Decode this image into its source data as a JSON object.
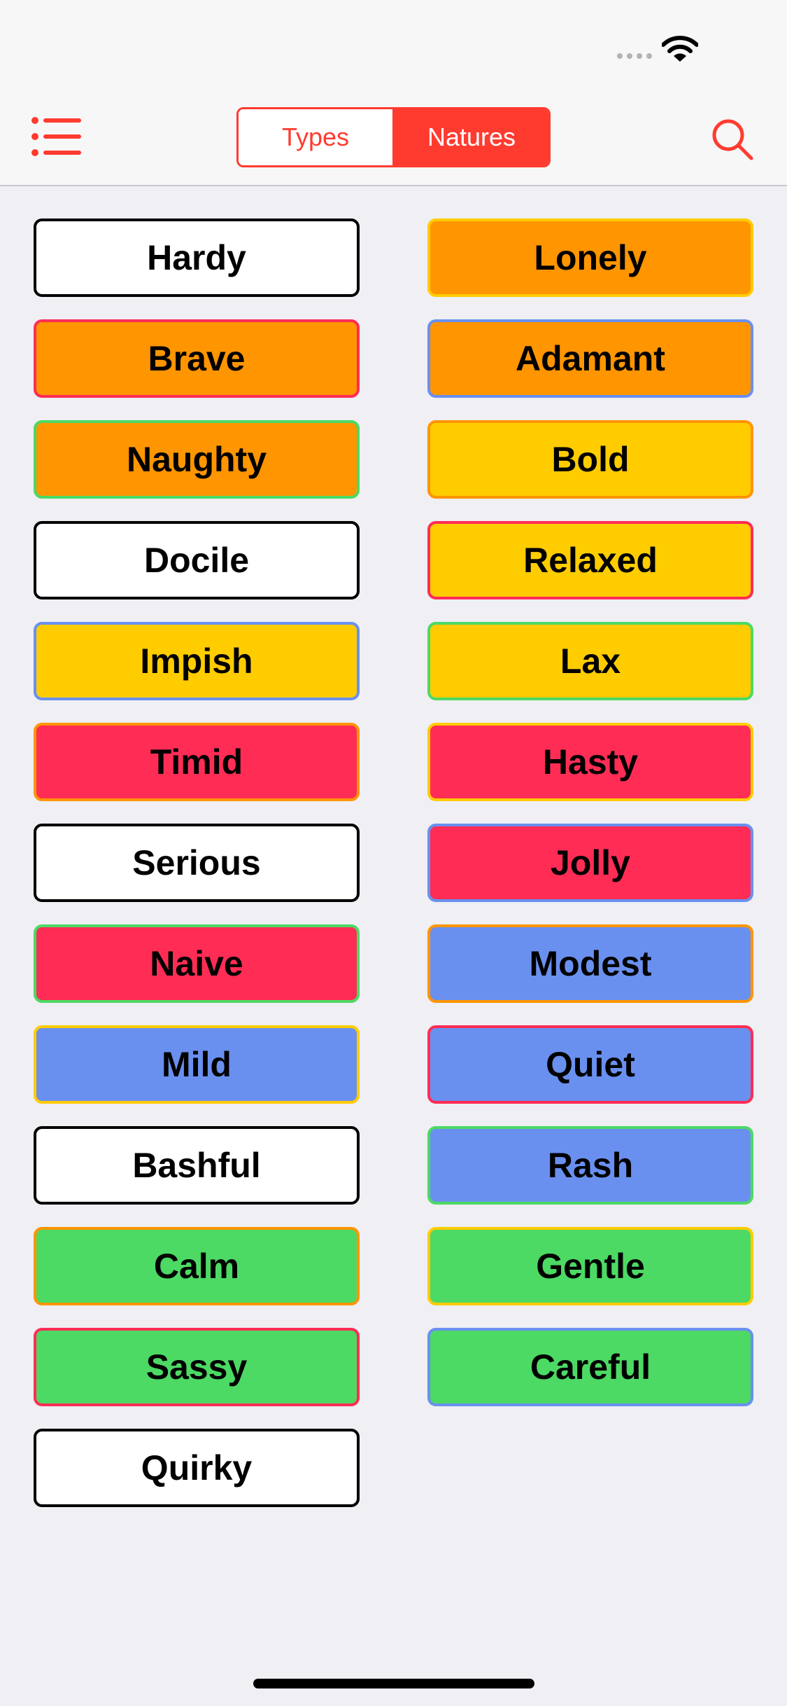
{
  "colors": {
    "accent": "#ff3b30",
    "white": "#ffffff",
    "black": "#000000",
    "orange": "#ff9500",
    "yellow": "#ffcc00",
    "red": "#ff2d55",
    "blue": "#6a90ef",
    "green": "#4cd964"
  },
  "navbar": {
    "menu_icon": "list-icon",
    "search_icon": "search-icon",
    "segments": [
      {
        "label": "Types",
        "selected": false
      },
      {
        "label": "Natures",
        "selected": true
      }
    ]
  },
  "natures": [
    {
      "label": "Hardy",
      "fill": "white",
      "border": "black"
    },
    {
      "label": "Lonely",
      "fill": "orange",
      "border": "yellow"
    },
    {
      "label": "Brave",
      "fill": "orange",
      "border": "red"
    },
    {
      "label": "Adamant",
      "fill": "orange",
      "border": "blue"
    },
    {
      "label": "Naughty",
      "fill": "orange",
      "border": "green"
    },
    {
      "label": "Bold",
      "fill": "yellow",
      "border": "orange"
    },
    {
      "label": "Docile",
      "fill": "white",
      "border": "black"
    },
    {
      "label": "Relaxed",
      "fill": "yellow",
      "border": "red"
    },
    {
      "label": "Impish",
      "fill": "yellow",
      "border": "blue"
    },
    {
      "label": "Lax",
      "fill": "yellow",
      "border": "green"
    },
    {
      "label": "Timid",
      "fill": "red",
      "border": "orange"
    },
    {
      "label": "Hasty",
      "fill": "red",
      "border": "yellow"
    },
    {
      "label": "Serious",
      "fill": "white",
      "border": "black"
    },
    {
      "label": "Jolly",
      "fill": "red",
      "border": "blue"
    },
    {
      "label": "Naive",
      "fill": "red",
      "border": "green"
    },
    {
      "label": "Modest",
      "fill": "blue",
      "border": "orange"
    },
    {
      "label": "Mild",
      "fill": "blue",
      "border": "yellow"
    },
    {
      "label": "Quiet",
      "fill": "blue",
      "border": "red"
    },
    {
      "label": "Bashful",
      "fill": "white",
      "border": "black"
    },
    {
      "label": "Rash",
      "fill": "blue",
      "border": "green"
    },
    {
      "label": "Calm",
      "fill": "green",
      "border": "orange"
    },
    {
      "label": "Gentle",
      "fill": "green",
      "border": "yellow"
    },
    {
      "label": "Sassy",
      "fill": "green",
      "border": "red"
    },
    {
      "label": "Careful",
      "fill": "green",
      "border": "blue"
    },
    {
      "label": "Quirky",
      "fill": "white",
      "border": "black"
    }
  ]
}
